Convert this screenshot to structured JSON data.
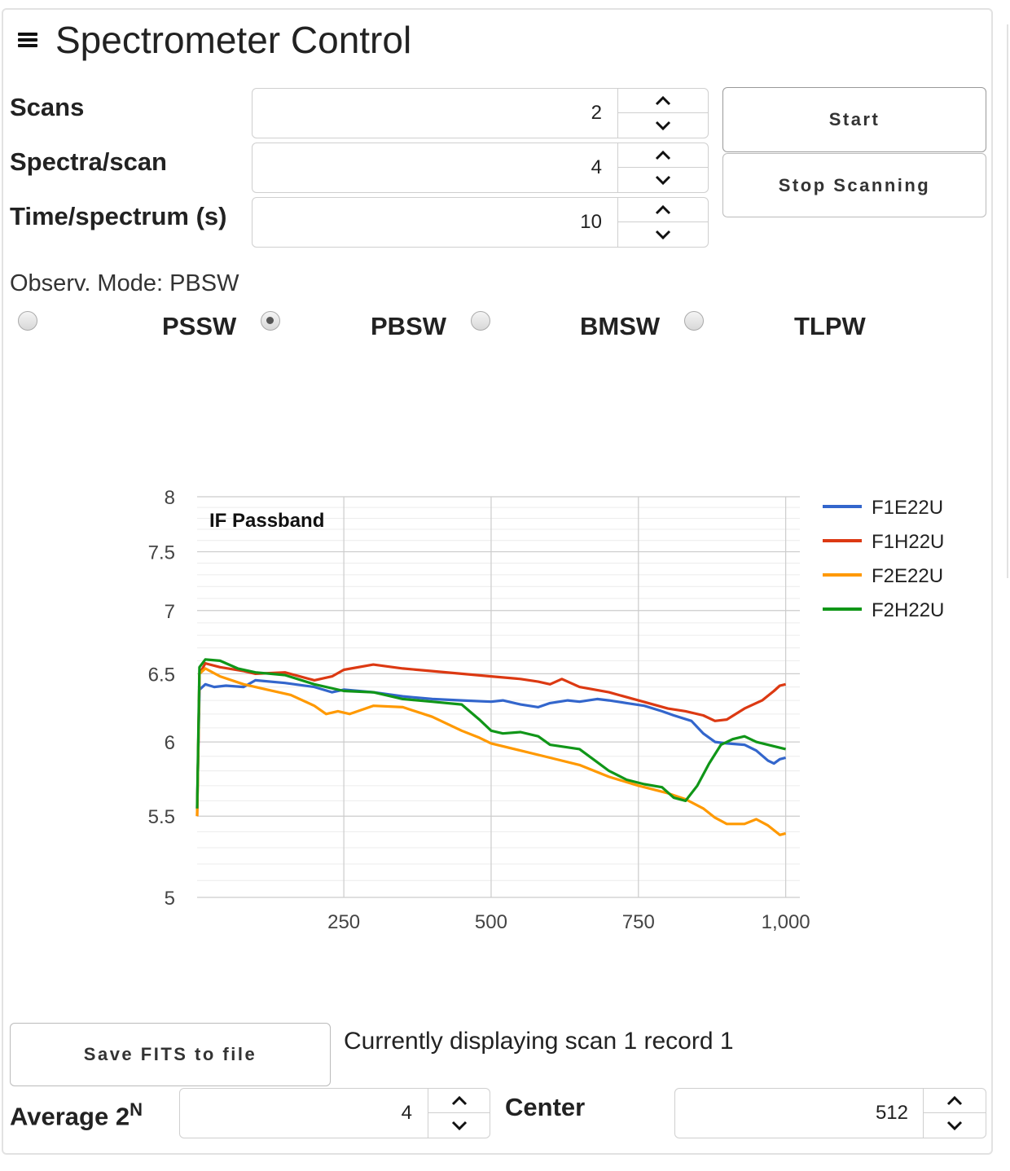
{
  "app": {
    "title": "Spectrometer Control"
  },
  "controls": {
    "scans": {
      "label": "Scans",
      "value": "2"
    },
    "spectra": {
      "label": "Spectra/scan",
      "value": "4"
    },
    "time": {
      "label": "Time/spectrum (s)",
      "value": "10"
    }
  },
  "buttons": {
    "start": "Start",
    "stop": "Stop Scanning",
    "save": "Save FITS to file"
  },
  "mode": {
    "text": "Observ. Mode: PBSW",
    "options": [
      "PSSW",
      "PBSW",
      "BMSW",
      "TLPW"
    ],
    "selected": "PBSW"
  },
  "status": "Currently displaying scan 1 record 1",
  "average": {
    "label": "Average 2",
    "sup": "N",
    "value": "4"
  },
  "center": {
    "label": "Center",
    "value": "512"
  },
  "chart_data": {
    "type": "line",
    "title": "IF Passband",
    "xlabel": "",
    "ylabel": "",
    "xlim": [
      1,
      1024
    ],
    "ylim": [
      5,
      8
    ],
    "y_scale": "log",
    "xticks": [
      "250",
      "500",
      "750",
      "1,000"
    ],
    "yticks": [
      "5",
      "5.5",
      "6",
      "6.5",
      "7",
      "7.5",
      "8"
    ],
    "grid": true,
    "legend": "right",
    "series": [
      {
        "name": "F1E22U",
        "color": "#3366cc",
        "points": [
          [
            1,
            5.55
          ],
          [
            5,
            6.38
          ],
          [
            15,
            6.42
          ],
          [
            30,
            6.4
          ],
          [
            50,
            6.41
          ],
          [
            80,
            6.4
          ],
          [
            100,
            6.45
          ],
          [
            150,
            6.43
          ],
          [
            200,
            6.4
          ],
          [
            230,
            6.36
          ],
          [
            250,
            6.38
          ],
          [
            300,
            6.36
          ],
          [
            350,
            6.33
          ],
          [
            400,
            6.31
          ],
          [
            450,
            6.3
          ],
          [
            500,
            6.29
          ],
          [
            520,
            6.3
          ],
          [
            550,
            6.27
          ],
          [
            580,
            6.25
          ],
          [
            600,
            6.28
          ],
          [
            630,
            6.3
          ],
          [
            650,
            6.29
          ],
          [
            680,
            6.31
          ],
          [
            700,
            6.3
          ],
          [
            730,
            6.28
          ],
          [
            760,
            6.26
          ],
          [
            790,
            6.22
          ],
          [
            810,
            6.19
          ],
          [
            840,
            6.15
          ],
          [
            860,
            6.06
          ],
          [
            880,
            6.0
          ],
          [
            900,
            5.99
          ],
          [
            930,
            5.98
          ],
          [
            950,
            5.94
          ],
          [
            970,
            5.87
          ],
          [
            980,
            5.85
          ],
          [
            990,
            5.88
          ],
          [
            1000,
            5.89
          ]
        ]
      },
      {
        "name": "F1H22U",
        "color": "#dc3912",
        "points": [
          [
            1,
            5.5
          ],
          [
            5,
            6.5
          ],
          [
            15,
            6.58
          ],
          [
            40,
            6.55
          ],
          [
            80,
            6.52
          ],
          [
            100,
            6.5
          ],
          [
            150,
            6.51
          ],
          [
            200,
            6.45
          ],
          [
            230,
            6.48
          ],
          [
            250,
            6.53
          ],
          [
            300,
            6.57
          ],
          [
            350,
            6.54
          ],
          [
            400,
            6.52
          ],
          [
            450,
            6.5
          ],
          [
            500,
            6.48
          ],
          [
            550,
            6.46
          ],
          [
            580,
            6.44
          ],
          [
            600,
            6.42
          ],
          [
            620,
            6.46
          ],
          [
            650,
            6.4
          ],
          [
            700,
            6.36
          ],
          [
            750,
            6.3
          ],
          [
            800,
            6.24
          ],
          [
            830,
            6.22
          ],
          [
            860,
            6.19
          ],
          [
            880,
            6.15
          ],
          [
            900,
            6.16
          ],
          [
            930,
            6.24
          ],
          [
            960,
            6.3
          ],
          [
            980,
            6.37
          ],
          [
            990,
            6.41
          ],
          [
            1000,
            6.42
          ]
        ]
      },
      {
        "name": "F2E22U",
        "color": "#ff9900",
        "points": [
          [
            1,
            5.5
          ],
          [
            5,
            6.5
          ],
          [
            15,
            6.54
          ],
          [
            40,
            6.48
          ],
          [
            80,
            6.42
          ],
          [
            120,
            6.38
          ],
          [
            160,
            6.34
          ],
          [
            200,
            6.26
          ],
          [
            220,
            6.2
          ],
          [
            240,
            6.22
          ],
          [
            260,
            6.2
          ],
          [
            300,
            6.26
          ],
          [
            350,
            6.25
          ],
          [
            400,
            6.18
          ],
          [
            450,
            6.08
          ],
          [
            480,
            6.03
          ],
          [
            500,
            5.99
          ],
          [
            550,
            5.94
          ],
          [
            600,
            5.89
          ],
          [
            650,
            5.84
          ],
          [
            700,
            5.76
          ],
          [
            750,
            5.7
          ],
          [
            800,
            5.65
          ],
          [
            830,
            5.61
          ],
          [
            860,
            5.55
          ],
          [
            880,
            5.49
          ],
          [
            900,
            5.45
          ],
          [
            930,
            5.45
          ],
          [
            950,
            5.48
          ],
          [
            970,
            5.44
          ],
          [
            990,
            5.38
          ],
          [
            1000,
            5.39
          ]
        ]
      },
      {
        "name": "F2H22U",
        "color": "#109618",
        "points": [
          [
            1,
            5.55
          ],
          [
            5,
            6.55
          ],
          [
            15,
            6.61
          ],
          [
            40,
            6.6
          ],
          [
            70,
            6.54
          ],
          [
            100,
            6.51
          ],
          [
            150,
            6.49
          ],
          [
            200,
            6.42
          ],
          [
            250,
            6.37
          ],
          [
            300,
            6.36
          ],
          [
            350,
            6.31
          ],
          [
            400,
            6.29
          ],
          [
            450,
            6.27
          ],
          [
            480,
            6.16
          ],
          [
            500,
            6.08
          ],
          [
            520,
            6.06
          ],
          [
            550,
            6.07
          ],
          [
            580,
            6.04
          ],
          [
            600,
            5.98
          ],
          [
            650,
            5.95
          ],
          [
            680,
            5.86
          ],
          [
            700,
            5.8
          ],
          [
            730,
            5.74
          ],
          [
            760,
            5.71
          ],
          [
            790,
            5.69
          ],
          [
            810,
            5.62
          ],
          [
            830,
            5.6
          ],
          [
            850,
            5.7
          ],
          [
            870,
            5.85
          ],
          [
            890,
            5.98
          ],
          [
            910,
            6.02
          ],
          [
            930,
            6.04
          ],
          [
            950,
            6.0
          ],
          [
            980,
            5.97
          ],
          [
            1000,
            5.95
          ]
        ]
      }
    ]
  }
}
